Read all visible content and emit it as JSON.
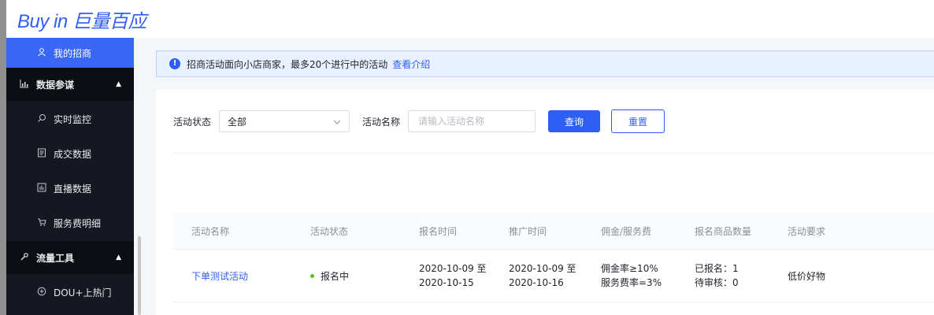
{
  "header": {
    "logo_text": "Buy in 巨量百应"
  },
  "sidebar": {
    "items": [
      {
        "label": "我的招商",
        "icon": "person-icon",
        "active": true
      },
      {
        "label": "数据参谋",
        "icon": "bar-chart-icon",
        "group": true,
        "expanded": true
      },
      {
        "label": "实时监控",
        "icon": "search-icon"
      },
      {
        "label": "成交数据",
        "icon": "document-icon"
      },
      {
        "label": "直播数据",
        "icon": "chart-box-icon"
      },
      {
        "label": "服务费明细",
        "icon": "cart-icon"
      },
      {
        "label": "流量工具",
        "icon": "wrench-icon",
        "group": true,
        "expanded": true
      },
      {
        "label": "DOU+上热门",
        "icon": "plus-circle-icon"
      }
    ]
  },
  "notice": {
    "text": "招商活动面向小店商家，最多20个进行中的活动",
    "link": "查看介绍"
  },
  "filter": {
    "status_label": "活动状态",
    "status_value": "全部",
    "name_label": "活动名称",
    "name_placeholder": "请输入活动名称",
    "query_button": "查询",
    "reset_button": "重置"
  },
  "table": {
    "columns": [
      "活动名称",
      "活动状态",
      "报名时间",
      "推广时间",
      "佣金/服务费",
      "报名商品数量",
      "活动要求"
    ],
    "rows": [
      {
        "name": "下单测试活动",
        "status": "报名中",
        "signup_time": [
          "2020-10-09 至",
          "2020-10-15"
        ],
        "promo_time": [
          "2020-10-09 至",
          "2020-10-16"
        ],
        "commission": [
          "佣金率≥10%",
          "服务费率=3%"
        ],
        "product_count": [
          "已报名：1",
          "待审核：0"
        ],
        "requirement": "低价好物"
      }
    ]
  },
  "colors": {
    "accent": "#2f5ff2",
    "sidebar_bg": "#151820",
    "status_green": "#52c41a"
  }
}
